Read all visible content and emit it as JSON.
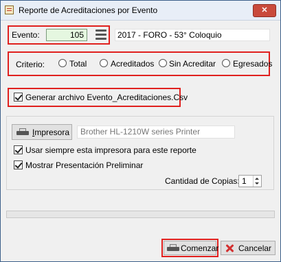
{
  "window": {
    "title": "Reporte de Acreditaciones por Evento",
    "close_glyph": "✕"
  },
  "evento": {
    "label": "Evento:",
    "number": "105",
    "name": "2017 - FORO - 53° Coloquio"
  },
  "criterio": {
    "label": "Criterio:",
    "options": [
      {
        "label": "Total",
        "selected": false
      },
      {
        "label": "Acreditados",
        "selected": false
      },
      {
        "label": "Sin Acreditar",
        "selected": false
      },
      {
        "label": "Egresados",
        "selected": false
      }
    ]
  },
  "generar_csv": {
    "label": "Generar archivo Evento_Acreditaciones.Csv",
    "checked": true
  },
  "printer": {
    "button_label": "Impresora",
    "button_mnemonic": "I",
    "button_rest": "mpresora",
    "name": "Brother HL-1210W series Printer",
    "always_use_label": "Usar siempre esta impresora para este reporte",
    "always_use_checked": true,
    "preview_label": "Mostrar Presentación Preliminar",
    "preview_checked": true,
    "copies_label": "Cantidad de Copias:",
    "copies": "1"
  },
  "progress": {
    "value": 0
  },
  "buttons": {
    "start_label": "Comenzar",
    "cancel_label": "Cancelar"
  },
  "colors": {
    "highlight": "#e0201e",
    "evento_field_bg": "#e5f7e0",
    "title_bg": "#e8eef7",
    "close_bg": "#c94a3c"
  },
  "icons": {
    "evento_menu": "hamburger-menu-icon",
    "printer": "printer-icon",
    "cancel": "red-x-icon",
    "app": "report-app-icon"
  }
}
